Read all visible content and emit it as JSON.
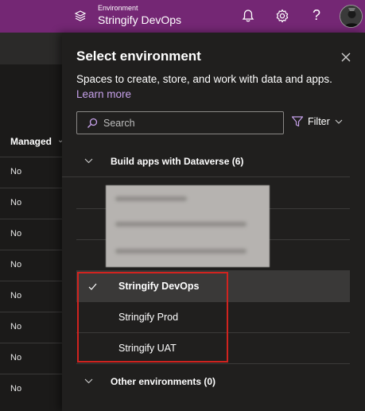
{
  "topbar": {
    "environment_label": "Environment",
    "environment_name": "Stringify DevOps",
    "icons": [
      "environment-icon",
      "bell-icon",
      "gear-icon",
      "help-icon",
      "avatar"
    ],
    "help_glyph": "?"
  },
  "background_table": {
    "header": "Managed",
    "rows": [
      "No",
      "No",
      "No",
      "No",
      "No",
      "No",
      "No",
      "No"
    ]
  },
  "panel": {
    "title": "Select environment",
    "description": "Spaces to create, store, and work with data and apps.",
    "learn_more": "Learn more",
    "search": {
      "placeholder": "Search",
      "value": ""
    },
    "filter_label": "Filter",
    "groups": [
      {
        "label": "Build apps with Dataverse (6)",
        "items": [
          {
            "label": "Stringify DevOps",
            "selected": true
          },
          {
            "label": "Stringify Prod",
            "selected": false
          },
          {
            "label": "Stringify UAT",
            "selected": false
          }
        ]
      },
      {
        "label": "Other environments (0)"
      }
    ]
  },
  "colors": {
    "topbar": "#742774",
    "panel_bg": "#201f1e",
    "selected_row": "#3a3938",
    "link": "#c6a1ea",
    "highlight_border": "#d1231f"
  }
}
